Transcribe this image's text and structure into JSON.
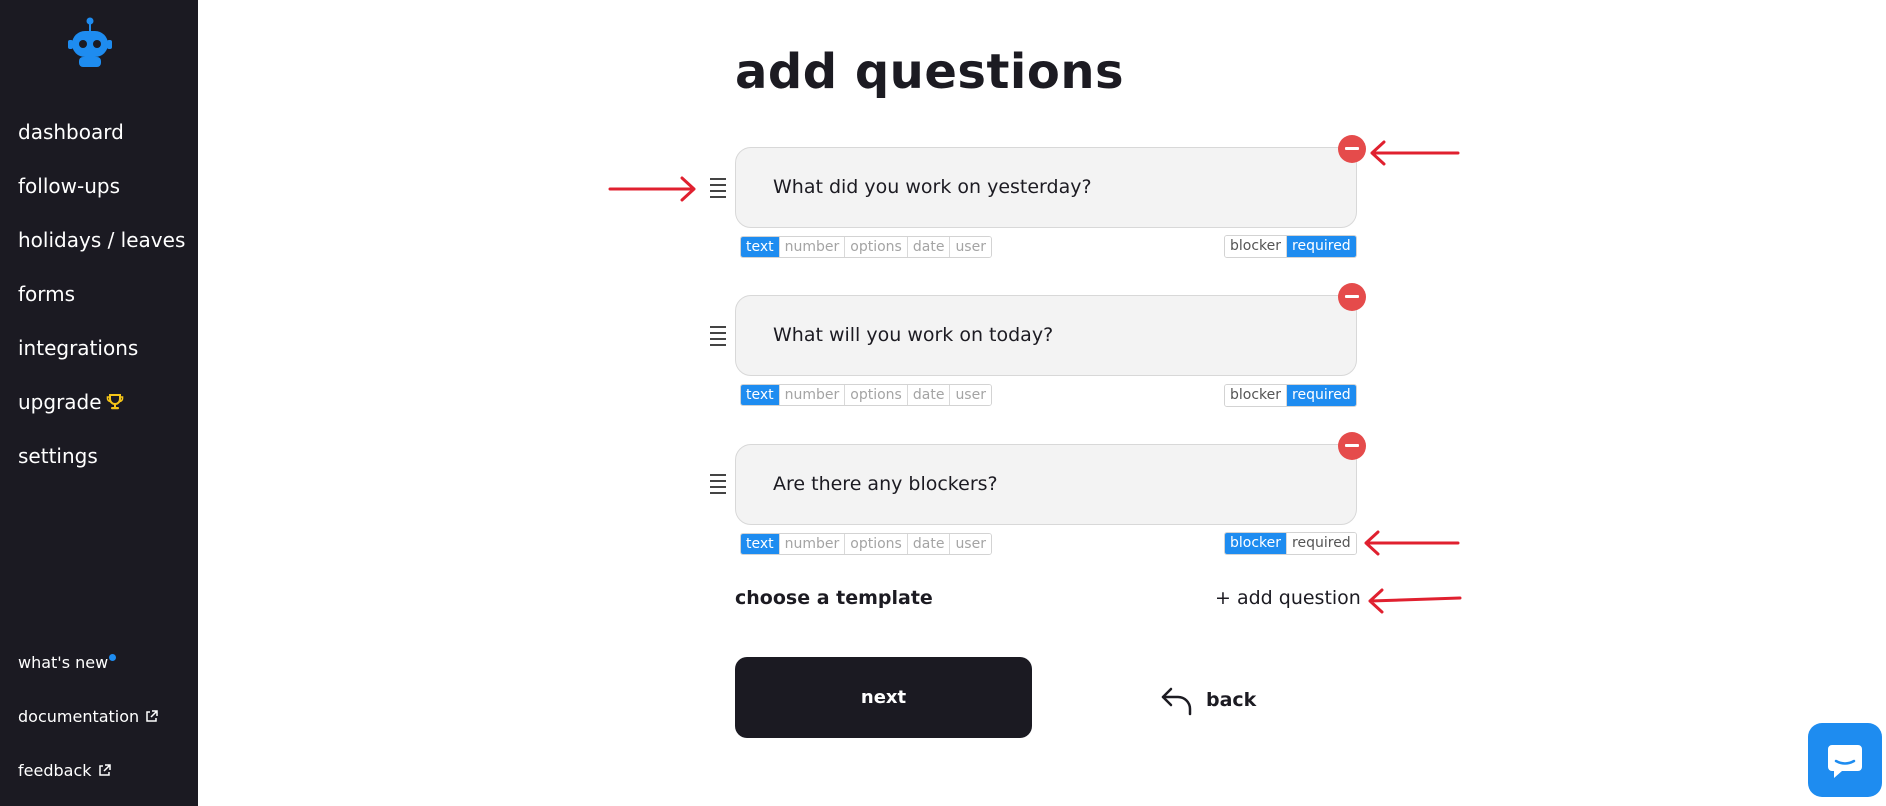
{
  "sidebar": {
    "nav": [
      {
        "label": "dashboard"
      },
      {
        "label": "follow-ups"
      },
      {
        "label": "holidays / leaves"
      },
      {
        "label": "forms"
      },
      {
        "label": "integrations"
      },
      {
        "label": "upgrade",
        "icon": "trophy-icon"
      },
      {
        "label": "settings"
      }
    ],
    "bottom": [
      {
        "label": "what's new",
        "icon": "notification-dot"
      },
      {
        "label": "documentation",
        "icon": "external-link-icon"
      },
      {
        "label": "feedback",
        "icon": "external-link-icon"
      }
    ]
  },
  "main": {
    "title": "add questions",
    "type_options": [
      "text",
      "number",
      "options",
      "date",
      "user"
    ],
    "flag_options": [
      "blocker",
      "required"
    ],
    "questions": [
      {
        "text": "What did you work on yesterday?",
        "type": "text",
        "blocker": false,
        "required": true
      },
      {
        "text": "What will you work on today?",
        "type": "text",
        "blocker": false,
        "required": true
      },
      {
        "text": "Are there any blockers?",
        "type": "text",
        "blocker": true,
        "required": false
      }
    ],
    "choose_template": "choose a template",
    "add_question": "+ add question",
    "next_label": "next",
    "back_label": "back"
  },
  "colors": {
    "sidebar_bg": "#1b1a22",
    "accent_blue": "#1e8cf0",
    "remove_red": "#e54b4b",
    "annotation_arrow": "#e0202f"
  }
}
